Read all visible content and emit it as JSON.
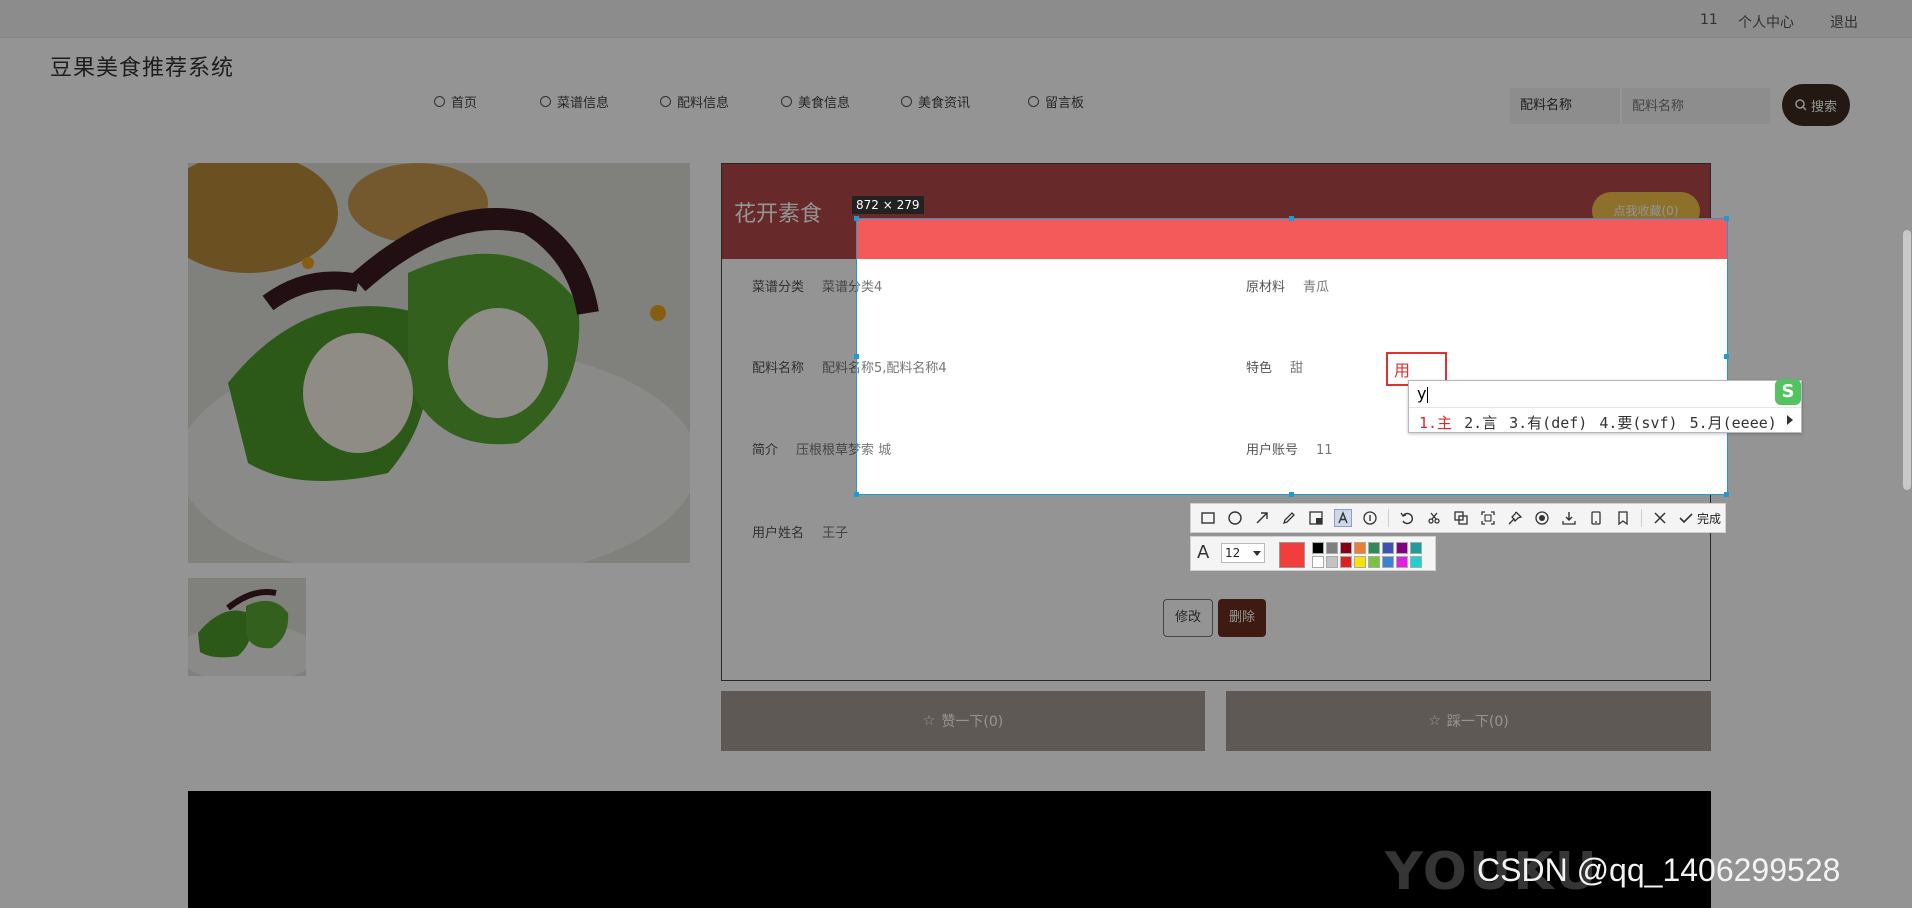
{
  "topbar": {
    "account": "11",
    "personal_center": "个人中心",
    "logout": "退出"
  },
  "site": {
    "brand": "豆果美食推荐系统"
  },
  "nav": [
    {
      "label": "首页",
      "icon": "home-icon"
    },
    {
      "label": "菜谱信息",
      "icon": "star-icon"
    },
    {
      "label": "配料信息",
      "icon": "bag-icon"
    },
    {
      "label": "美食信息",
      "icon": "info-icon"
    },
    {
      "label": "美食资讯",
      "icon": "info-icon"
    },
    {
      "label": "留言板",
      "icon": "info-icon"
    }
  ],
  "search": {
    "field_select": "配料名称",
    "placeholder": "配料名称",
    "button_label": "搜索"
  },
  "detail": {
    "title": "花开素食",
    "favorite_button": "点我收藏(0)",
    "fields": {
      "category_label": "菜谱分类",
      "category_value": "菜谱分类4",
      "raw_label": "原材料",
      "raw_value": "青瓜",
      "ingredients_label": "配料名称",
      "ingredients_value": "配料名称5,配料名称4",
      "feature_label": "特色",
      "feature_value": "甜",
      "intro_label": "简介",
      "intro_value": "压根根草梦索 城",
      "account_label": "用户账号",
      "account_value": "11",
      "username_label": "用户姓名",
      "username_value": "王子"
    },
    "edit_button": "修改",
    "delete_button": "删除",
    "like_button": "赞一下(0)",
    "dislike_button": "踩一下(0)"
  },
  "video": {
    "logo_text": "YOUKU"
  },
  "capture": {
    "size_label": "872 × 279",
    "text_box_value": "用",
    "ime": {
      "input": "y",
      "candidates": [
        "1.主",
        "2.言",
        "3.有(def)",
        "4.要(svf)",
        "5.月(eeee)"
      ],
      "logo": "S"
    },
    "toolbar_done": "完成",
    "font_size": "12",
    "current_color": "#f23d3d",
    "swatches": [
      "#000000",
      "#7f7f7f",
      "#880015",
      "#ed7d31",
      "#2e8b57",
      "#3f51b5",
      "#800080",
      "#1b9e9e",
      "#ffffff",
      "#c3c3c3",
      "#e02020",
      "#f4e400",
      "#7cc242",
      "#3b82d0",
      "#e020e0",
      "#20d0d0"
    ]
  },
  "watermark": "CSDN @qq_1406299528"
}
